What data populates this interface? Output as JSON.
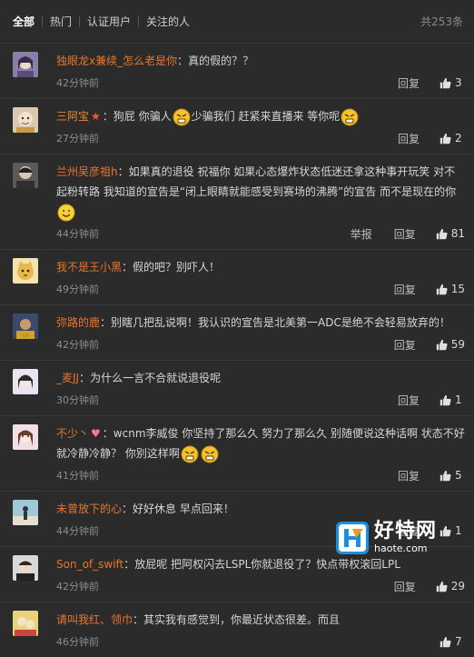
{
  "tabs": {
    "all": "全部",
    "hot": "热门",
    "verified": "认证用户",
    "following": "关注的人",
    "total": "共253条"
  },
  "actions": {
    "reply": "回复",
    "report": "举报"
  },
  "comments": [
    {
      "user": "独眼龙x兼续_怎么老是你",
      "sep": "：",
      "text": "真的假的？？",
      "time": "42分钟前",
      "likes": "3"
    },
    {
      "user": "三阿宝",
      "sep": "：",
      "text": "狗屁 你骗人",
      "text2": "少骗我们 赶紧来直播来 等你呢",
      "time": "27分钟前",
      "likes": "2"
    },
    {
      "user": "兰州吴彦祖h",
      "sep": "：",
      "text": "如果真的退役 祝福你 如果心态爆炸状态低迷还拿这种事开玩笑 对不起粉转路 我知道的宣告是“闭上眼睛就能感受到赛场的沸腾”的宣告 而不是现在的你",
      "time": "44分钟前",
      "likes": "81"
    },
    {
      "user": "我不是王小黑",
      "sep": "：",
      "text": "假的吧？别吓人！",
      "time": "49分钟前",
      "likes": "15"
    },
    {
      "user": "弥路的鹿",
      "sep": "：",
      "text": "别瞎几把乱说啊！我认识的宣告是北美第一ADC是绝不会轻易放弃的！",
      "time": "42分钟前",
      "likes": "59"
    },
    {
      "user": "_麦JJ",
      "sep": "：",
      "text": "为什么一言不合就说退役呢",
      "time": "30分钟前",
      "likes": "1"
    },
    {
      "user": "不少丶",
      "sep": "：",
      "text": "wcnm李威俊 你坚持了那么久 努力了那么久 别随便说这种话啊 状态不好就冷静冷静？ 你别这样啊",
      "time": "41分钟前",
      "likes": "5"
    },
    {
      "user": "未曾放下的心",
      "sep": "：",
      "text": "好好休息 早点回来！",
      "time": "44分钟前",
      "likes": "1"
    },
    {
      "user": "Son_of_swift",
      "sep": "：",
      "text": "放屁呢 把阿权闪去LSPL你就退役了？快点带权滚回LPL",
      "time": "42分钟前",
      "likes": "29"
    },
    {
      "user": "请叫我红、领巾",
      "sep": "：",
      "text": "其实我有感觉到，你最近状态很差。而且",
      "time": "46分钟前",
      "likes": "7"
    }
  ],
  "watermark": {
    "cn": "好特网",
    "url": "haote.com"
  },
  "colors": {
    "background": "#2b2b2b",
    "username": "#e8762d",
    "text": "#d6d6d6",
    "muted": "#8d8d8d",
    "divider": "#3a3a3a"
  }
}
